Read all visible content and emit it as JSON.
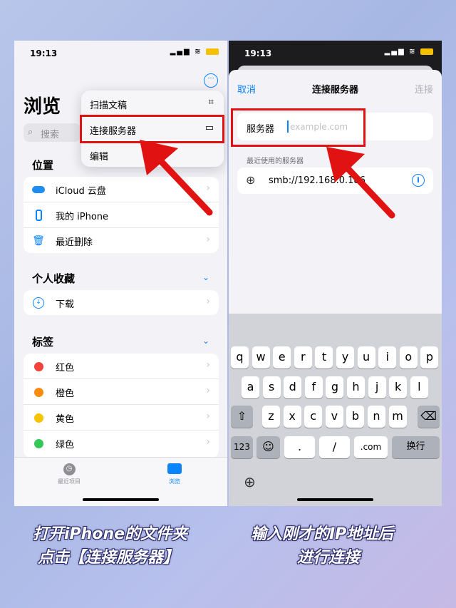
{
  "left": {
    "status_time": "19:13",
    "title": "浏览",
    "search_placeholder": "搜索",
    "menu": [
      "扫描文稿",
      "连接服务器",
      "编辑"
    ],
    "section_locations": "位置",
    "locations": [
      "iCloud 云盘",
      "我的 iPhone",
      "最近删除"
    ],
    "section_favorites": "个人收藏",
    "favorites": [
      "下载"
    ],
    "section_tags": "标签",
    "tags": [
      {
        "label": "红色",
        "color": "#f2433a"
      },
      {
        "label": "橙色",
        "color": "#fa8c11"
      },
      {
        "label": "黄色",
        "color": "#f5c400"
      },
      {
        "label": "绿色",
        "color": "#34c759"
      }
    ],
    "tab_recent": "最近项目",
    "tab_browse": "浏览"
  },
  "right": {
    "status_time": "19:13",
    "cancel": "取消",
    "title": "连接服务器",
    "connect": "连接",
    "server_label": "服务器",
    "server_placeholder": "example.com",
    "recent_header": "最近使用的服务器",
    "recent_server": "smb://192.168.0.186",
    "kb_row1": [
      "q",
      "w",
      "e",
      "r",
      "t",
      "y",
      "u",
      "i",
      "o",
      "p"
    ],
    "kb_row2": [
      "a",
      "s",
      "d",
      "f",
      "g",
      "h",
      "j",
      "k",
      "l"
    ],
    "kb_row3": [
      "z",
      "x",
      "c",
      "v",
      "b",
      "n",
      "m"
    ],
    "kb_bottom": [
      "123",
      ".",
      "/",
      ".com",
      "换行"
    ]
  },
  "captions": {
    "left_line1": "打开iPhone的文件夹",
    "left_line2": "点击【连接服务器】",
    "right_line1": "输入刚才的IP地址后",
    "right_line2": "进行连接"
  },
  "colors": {
    "accent": "#0a84ff",
    "highlight": "#e01212"
  }
}
